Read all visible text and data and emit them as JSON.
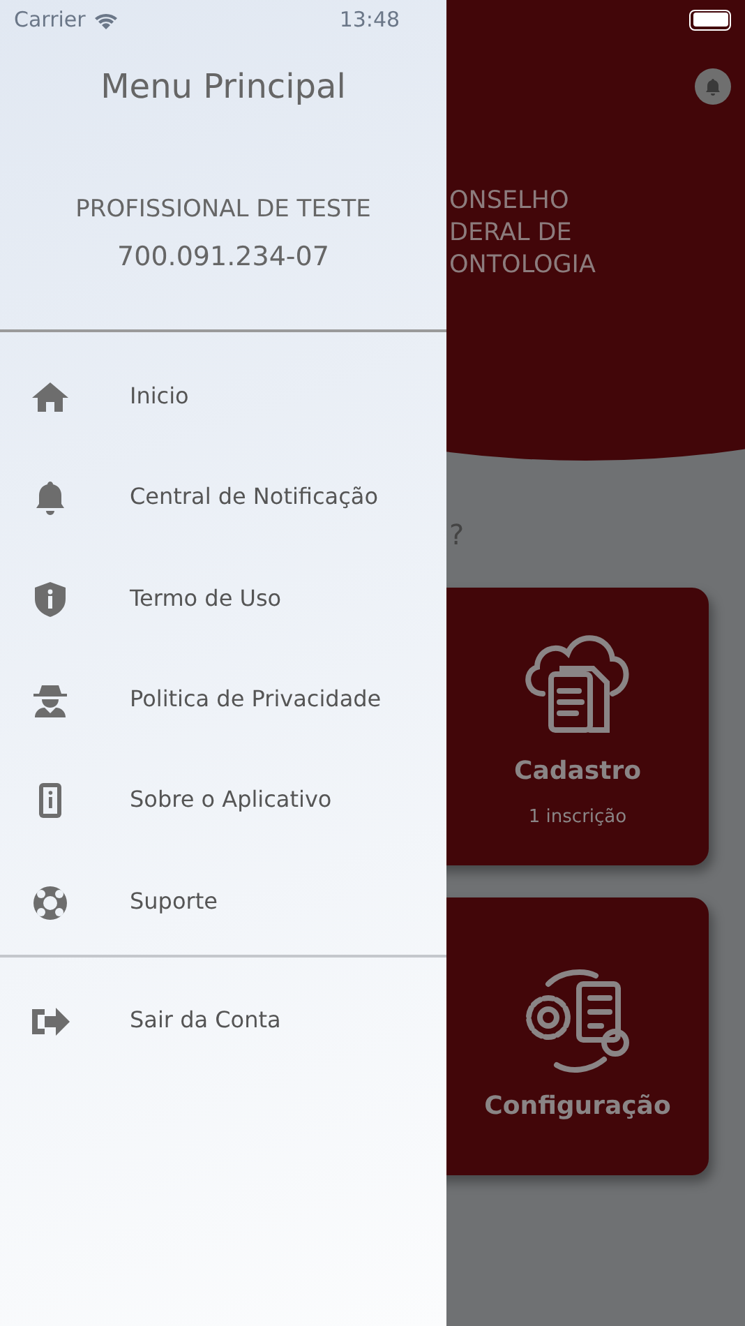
{
  "status_bar": {
    "carrier": "Carrier",
    "time": "13:48"
  },
  "drawer": {
    "title": "Menu Principal",
    "user_name": "PROFISSIONAL DE TESTE",
    "user_id": "700.091.234-07",
    "items": [
      {
        "kind": "home",
        "label": "Inicio"
      },
      {
        "kind": "bell",
        "label": "Central de Notificação"
      },
      {
        "kind": "shield",
        "label": "Termo de Uso"
      },
      {
        "kind": "spy",
        "label": "Politica de Privacidade"
      },
      {
        "kind": "phone",
        "label": "Sobre o Aplicativo"
      },
      {
        "kind": "lifebuoy",
        "label": "Suporte"
      }
    ],
    "footer_items": [
      {
        "kind": "logout",
        "label": "Sair da Conta"
      }
    ]
  },
  "background": {
    "brand_lines": [
      "ONSELHO",
      "DERAL DE",
      "ONTOLOGIA"
    ],
    "heading_fragment": "?",
    "cards": [
      {
        "kind": "cloud-docs",
        "title": "Cadastro",
        "subtitle": "1 inscrição"
      },
      {
        "kind": "gear-doc",
        "title": "Configuração"
      }
    ]
  }
}
